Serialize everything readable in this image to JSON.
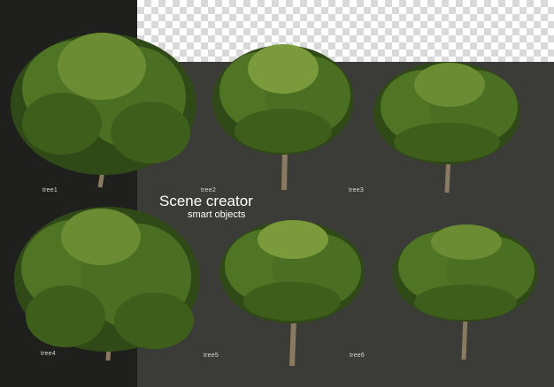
{
  "title": "Scene creator",
  "subtitle": "smart objects",
  "trees": [
    {
      "label": "tree1"
    },
    {
      "label": "tree2"
    },
    {
      "label": "tree3"
    },
    {
      "label": "tree4"
    },
    {
      "label": "tree5"
    },
    {
      "label": "tree6"
    }
  ],
  "colors": {
    "left_panel": "#1f1f1d",
    "right_panel": "#3b3b38",
    "foliage_dark": "#2f4a17",
    "foliage_mid": "#4f7424",
    "foliage_light": "#7a9a3c",
    "trunk": "#8a7a60"
  }
}
